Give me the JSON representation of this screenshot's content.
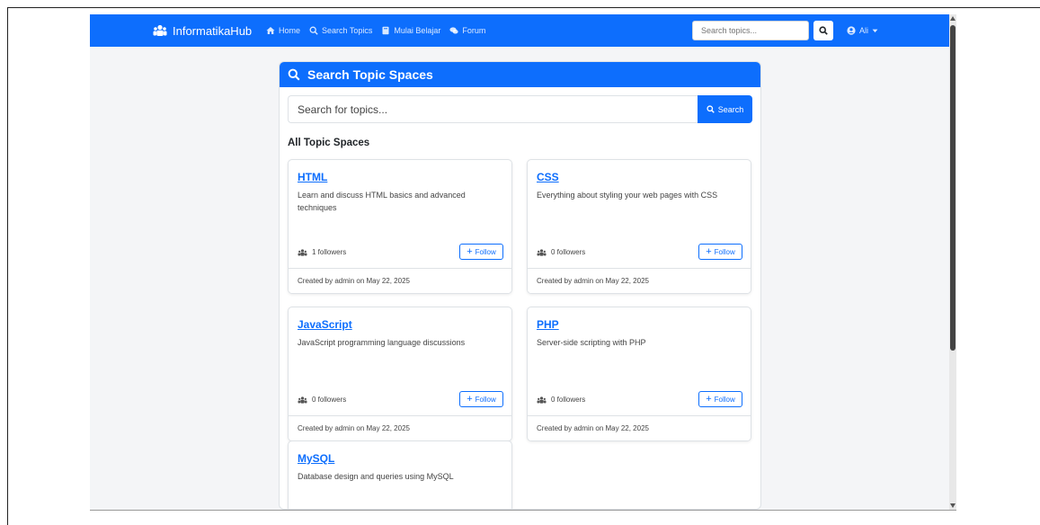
{
  "navbar": {
    "brand": "InformatikaHub",
    "links": [
      {
        "label": "Home",
        "icon": "home-icon"
      },
      {
        "label": "Search Topics",
        "icon": "search-icon"
      },
      {
        "label": "Mulai Belajar",
        "icon": "book-icon"
      },
      {
        "label": "Forum",
        "icon": "comments-icon"
      }
    ],
    "search_placeholder": "Search topics...",
    "user": "Ali"
  },
  "panel": {
    "title": "Search Topic Spaces",
    "search_placeholder": "Search for topics...",
    "search_button": "Search",
    "section_title": "All Topic Spaces"
  },
  "topics": [
    {
      "title": "HTML",
      "description": "Learn and discuss HTML basics and advanced techniques",
      "followers": "1 followers",
      "follow_label": "Follow",
      "footer": "Created by admin on May 22, 2025"
    },
    {
      "title": "CSS",
      "description": "Everything about styling your web pages with CSS",
      "followers": "0 followers",
      "follow_label": "Follow",
      "footer": "Created by admin on May 22, 2025"
    },
    {
      "title": "JavaScript",
      "description": "JavaScript programming language discussions",
      "followers": "0 followers",
      "follow_label": "Follow",
      "footer": "Created by admin on May 22, 2025"
    },
    {
      "title": "PHP",
      "description": "Server-side scripting with PHP",
      "followers": "0 followers",
      "follow_label": "Follow",
      "footer": "Created by admin on May 22, 2025"
    },
    {
      "title": "MySQL",
      "description": "Database design and queries using MySQL",
      "followers": "",
      "follow_label": "",
      "footer": ""
    }
  ],
  "colors": {
    "primary": "#0d6efd",
    "background": "#f4f5f7"
  }
}
